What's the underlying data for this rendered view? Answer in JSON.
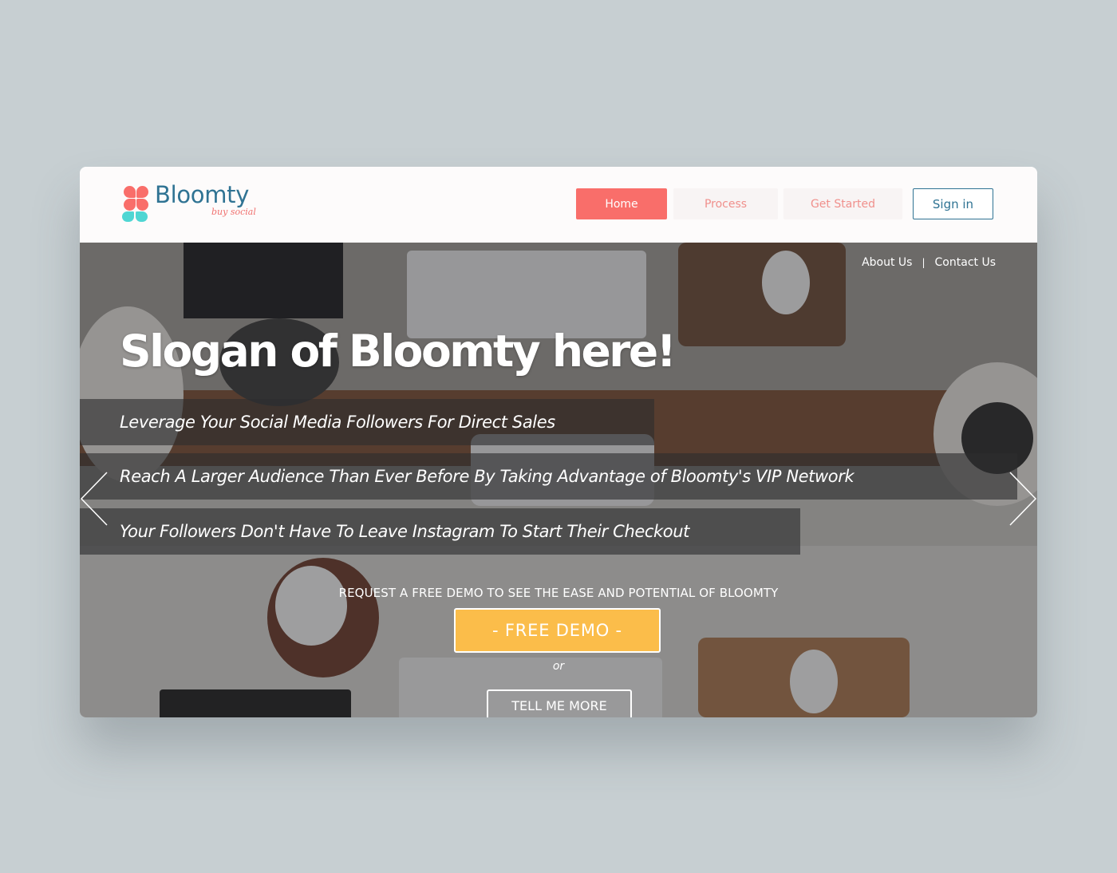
{
  "brand": {
    "name": "Bloomty",
    "tagline": "buy social",
    "colors": {
      "coral": "#f96e6a",
      "teal": "#2f7393",
      "cyan": "#4fd6d3",
      "yellow": "#fbbd4a"
    }
  },
  "nav": {
    "items": [
      {
        "label": "Home",
        "active": true
      },
      {
        "label": "Process",
        "active": false
      },
      {
        "label": "Get Started",
        "active": false
      }
    ],
    "signin_label": "Sign in"
  },
  "subnav": {
    "about_label": "About Us",
    "separator": "|",
    "contact_label": "Contact Us"
  },
  "hero": {
    "slogan": "Slogan of Bloomty here!",
    "features": [
      "Leverage Your Social Media Followers For Direct Sales",
      "Reach A Larger Audience Than Ever Before By Taking Advantage of Bloomty's VIP Network",
      "Your Followers Don't Have To Leave Instagram To Start Their Checkout"
    ],
    "cta_text": "REQUEST A FREE DEMO TO SEE THE EASE AND POTENTIAL OF BLOOMTY",
    "demo_label": "- FREE DEMO -",
    "or_text": "or",
    "more_label": "TELL ME MORE",
    "icons": {
      "prev": "chevron-left-icon",
      "next": "chevron-right-icon"
    }
  }
}
